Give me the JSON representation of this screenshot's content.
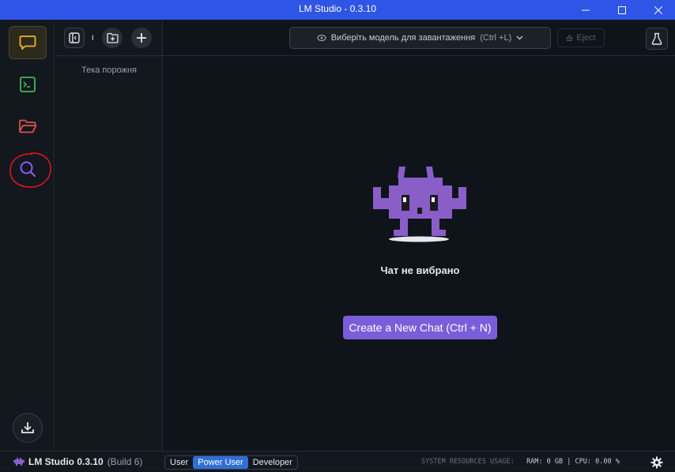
{
  "window": {
    "title": "LM Studio - 0.3.10",
    "minimize_icon": "minimize-icon",
    "maximize_icon": "maximize-icon",
    "close_icon": "close-icon"
  },
  "sidebar": {
    "items": [
      {
        "name": "chat",
        "icon": "chat-bubble-icon",
        "color": "#f0b429",
        "active": true
      },
      {
        "name": "developer",
        "icon": "terminal-icon",
        "color": "#3fb950"
      },
      {
        "name": "my-models",
        "icon": "folder-icon",
        "color": "#e05252"
      },
      {
        "name": "discover",
        "icon": "search-icon",
        "color": "#8b5cf6"
      }
    ],
    "download_icon": "download-icon"
  },
  "chat_list": {
    "empty_text": "Тека порожня",
    "separator": "ι"
  },
  "topbar": {
    "model_select_label": "Виберіть модель для завантаження",
    "model_select_shortcut": "(Ctrl +L)",
    "eject_label": "Eject"
  },
  "main": {
    "no_chat_text": "Чат не вибрано",
    "create_chat_label": "Create a New Chat (Ctrl + N)"
  },
  "statusbar": {
    "app_name": "LM Studio 0.3.10",
    "build": "(Build 6)",
    "modes": [
      "User",
      "Power User",
      "Developer"
    ],
    "active_mode": "Power User",
    "resources_label": "SYSTEM RESOURCES USAGE:",
    "ram_label": "RAM:",
    "ram_value": "0 GB",
    "separator": "|",
    "cpu_label": "CPU:",
    "cpu_value": "0.00 %"
  },
  "colors": {
    "titlebar": "#2f55e6",
    "accent_purple": "#7a5ed9",
    "active_mode": "#2f6fd6",
    "annotation_circle": "#e0141e"
  }
}
